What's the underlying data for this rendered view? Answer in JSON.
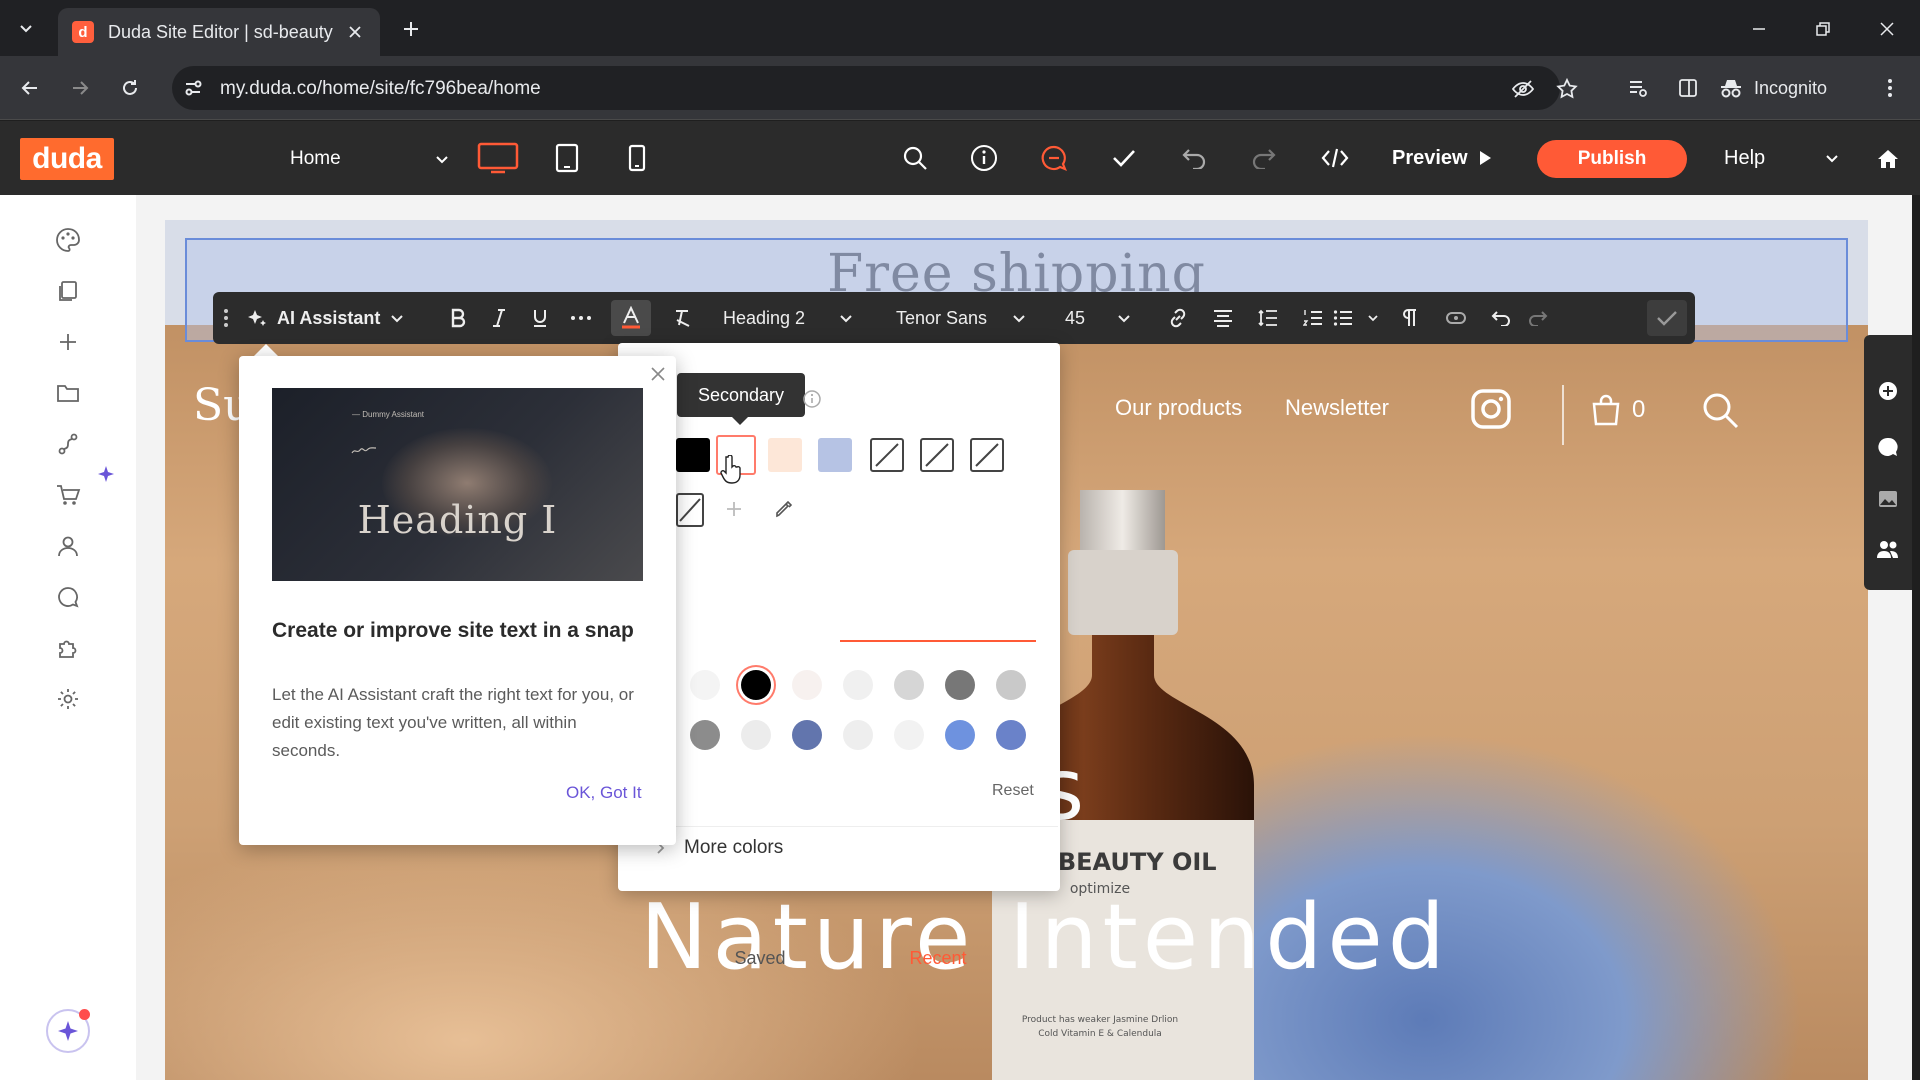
{
  "browser": {
    "tab_title": "Duda Site Editor | sd-beauty",
    "favicon_letter": "d",
    "url": "my.duda.co/home/site/fc796bea/home",
    "incognito_label": "Incognito"
  },
  "editor": {
    "logo": "duda",
    "page_select": "Home",
    "preview_label": "Preview",
    "publish_label": "Publish",
    "help_label": "Help",
    "colors": {
      "accent": "#ff5a36",
      "bar": "#2b2b2b",
      "selection": "#6a8cd9"
    }
  },
  "sidebar": {
    "icons": [
      "palette-icon",
      "pages-icon",
      "add-icon",
      "folder-icon",
      "route-icon",
      "cart-icon",
      "user-icon",
      "comment-icon",
      "puzzle-icon",
      "settings-icon"
    ]
  },
  "site": {
    "announcement": "Free shipping",
    "logo_partial": "Su",
    "nav": [
      "Our products",
      "Newsletter"
    ],
    "cart_count": "0",
    "hero_line1": "re as",
    "hero_line2": "Nature Intended",
    "bottle_label": "N BEAUTY OIL",
    "bottle_sublabel": "optimize",
    "bottle_fine": [
      "Product has weaker Jasmine Drlion",
      "Cold Vitamin E & Calendula"
    ]
  },
  "text_toolbar": {
    "ai_assistant": "AI Assistant",
    "heading_style": "Heading 2",
    "font": "Tenor Sans",
    "font_size": "45"
  },
  "color_picker": {
    "tooltip": "Secondary",
    "tabs": [
      "Saved",
      "Recent"
    ],
    "active_tab": "Recent",
    "reset_label": "Reset",
    "more_colors": "More colors",
    "theme_swatches": [
      "#000000",
      "#ffffff",
      "#fde7d8",
      "#b6c3e4"
    ],
    "recent_row1": [
      "#f4f4f4",
      "#000000",
      "#f7f1ef",
      "#f0f0f0",
      "#d6d6d6",
      "#777777",
      "#c9c9c9"
    ],
    "recent_row2": [
      "#8c8c8c",
      "#ececec",
      "#6275ad",
      "#eeeeee",
      "#f2f2f2",
      "#6e92df",
      "#6a82c9"
    ]
  },
  "ai_card": {
    "image_heading": "Heading I",
    "image_nav": "— Dummy Assistant",
    "title": "Create or improve site text in a snap",
    "body": "Let the AI Assistant craft the right text for you, or edit existing text you've written, all within seconds.",
    "ok_label": "OK, Got It"
  }
}
